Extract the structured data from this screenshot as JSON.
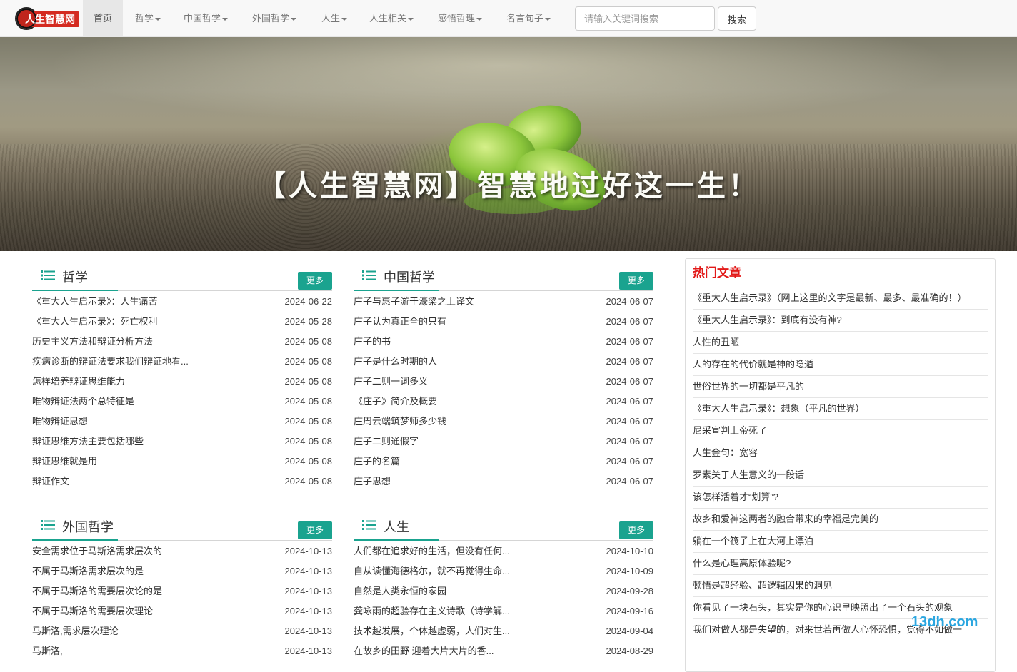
{
  "nav": {
    "logo_text": "人生智慧网",
    "items": [
      {
        "label": "首页",
        "dropdown": false,
        "active": true
      },
      {
        "label": "哲学",
        "dropdown": true
      },
      {
        "label": "中国哲学",
        "dropdown": true
      },
      {
        "label": "外国哲学",
        "dropdown": true
      },
      {
        "label": "人生",
        "dropdown": true
      },
      {
        "label": "人生相关",
        "dropdown": true
      },
      {
        "label": "感悟哲理",
        "dropdown": true
      },
      {
        "label": "名言句子",
        "dropdown": true
      }
    ],
    "search_placeholder": "请输入关键词搜索",
    "search_button": "搜索"
  },
  "banner": {
    "title": "【人生智慧网】智慧地过好这一生！"
  },
  "sections": [
    {
      "title": "哲学",
      "more": "更多",
      "items": [
        {
          "title": "《重大人生启示录》：人生痛苦",
          "date": "2024-06-22"
        },
        {
          "title": "《重大人生启示录》：死亡权利",
          "date": "2024-05-28"
        },
        {
          "title": "历史主义方法和辩证分析方法",
          "date": "2024-05-08"
        },
        {
          "title": "疾病诊断的辩证法要求我们辩证地看...",
          "date": "2024-05-08"
        },
        {
          "title": "怎样培养辩证思维能力",
          "date": "2024-05-08"
        },
        {
          "title": "唯物辩证法两个总特征是",
          "date": "2024-05-08"
        },
        {
          "title": "唯物辩证思想",
          "date": "2024-05-08"
        },
        {
          "title": "辩证思维方法主要包括哪些",
          "date": "2024-05-08"
        },
        {
          "title": "辩证思维就是用",
          "date": "2024-05-08"
        },
        {
          "title": "辩证作文",
          "date": "2024-05-08"
        }
      ]
    },
    {
      "title": "中国哲学",
      "more": "更多",
      "items": [
        {
          "title": "庄子与惠子游于濠梁之上译文",
          "date": "2024-06-07"
        },
        {
          "title": "庄子认为真正全的只有",
          "date": "2024-06-07"
        },
        {
          "title": "庄子的书",
          "date": "2024-06-07"
        },
        {
          "title": "庄子是什么时期的人",
          "date": "2024-06-07"
        },
        {
          "title": "庄子二则一词多义",
          "date": "2024-06-07"
        },
        {
          "title": "《庄子》简介及概要",
          "date": "2024-06-07"
        },
        {
          "title": "庄周云端筑梦师多少钱",
          "date": "2024-06-07"
        },
        {
          "title": "庄子二则通假字",
          "date": "2024-06-07"
        },
        {
          "title": "庄子的名篇",
          "date": "2024-06-07"
        },
        {
          "title": "庄子思想",
          "date": "2024-06-07"
        }
      ]
    },
    {
      "title": "外国哲学",
      "more": "更多",
      "items": [
        {
          "title": "安全需求位于马斯洛需求层次的",
          "date": "2024-10-13"
        },
        {
          "title": "不属于马斯洛需求层次的是",
          "date": "2024-10-13"
        },
        {
          "title": "不属于马斯洛的需要层次论的是",
          "date": "2024-10-13"
        },
        {
          "title": "不属于马斯洛的需要层次理论",
          "date": "2024-10-13"
        },
        {
          "title": "马斯洛,需求层次理论",
          "date": "2024-10-13"
        },
        {
          "title": "马斯洛,",
          "date": "2024-10-13"
        }
      ]
    },
    {
      "title": "人生",
      "more": "更多",
      "items": [
        {
          "title": "人们都在追求好的生活，但没有任何...",
          "date": "2024-10-10"
        },
        {
          "title": "自从读懂海德格尔，就不再觉得生命...",
          "date": "2024-10-09"
        },
        {
          "title": "自然是人类永恒的家园",
          "date": "2024-09-28"
        },
        {
          "title": "龚咏雨的超验存在主义诗歌（诗学解...",
          "date": "2024-09-16"
        },
        {
          "title": "技术越发展，个体越虚弱，人们对生...",
          "date": "2024-09-04"
        },
        {
          "title": "在故乡的田野 迎着大片大片的香...",
          "date": "2024-08-29"
        }
      ]
    }
  ],
  "hot": {
    "title": "热门文章",
    "items": [
      "《重大人生启示录》（网上这里的文字是最新、最多、最准确的！）",
      "《重大人生启示录》：到底有没有神?",
      "人性的丑陋",
      "人的存在的代价就是神的隐遁",
      "世俗世界的一切都是平凡的",
      "《重大人生启示录》：想象（平凡的世界）",
      "尼采宣判上帝死了",
      "人生金句：宽容",
      "罗素关于人生意义的一段话",
      "该怎样活着才“划算”?",
      "故乡和爱神这两者的融合带来的幸福是完美的",
      "躺在一个筏子上在大河上漂泊",
      "什么是心理高原体验呢?",
      "顿悟是超经验、超逻辑因果的洞见",
      "你看见了一块石头，其实是你的心识里映照出了一个石头的观象",
      "我们对做人都是失望的，对来世若再做人心怀恐惧，觉得不如做一"
    ]
  },
  "watermark": "13dh.com"
}
